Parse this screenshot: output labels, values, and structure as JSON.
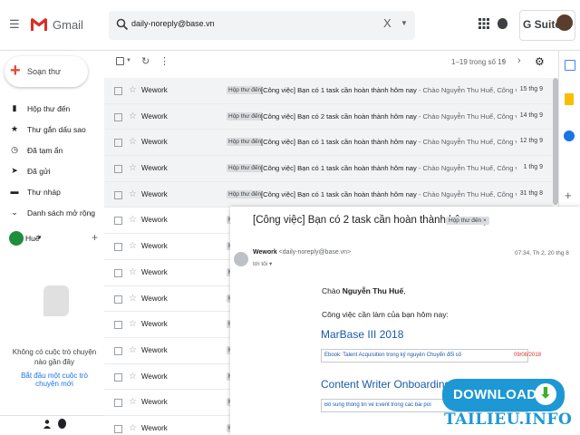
{
  "header": {
    "app_name": "Gmail",
    "search_value": "daily-noreply@base.vn",
    "clear_symbol": "X",
    "gsuite_label": "G Suite"
  },
  "sidebar": {
    "compose_label": "Soạn thư",
    "items": [
      {
        "label": "Hộp thư đến",
        "icon": "inbox-icon"
      },
      {
        "label": "Thư gắn dấu sao",
        "icon": "star-icon"
      },
      {
        "label": "Đã tạm ẩn",
        "icon": "clock-icon"
      },
      {
        "label": "Đã gửi",
        "icon": "send-icon"
      },
      {
        "label": "Thư nháp",
        "icon": "draft-icon"
      },
      {
        "label": "Danh sách mở rộng",
        "icon": "chevron-down-icon"
      }
    ],
    "chat_user": "Huế",
    "no_chat_text": "Không có cuộc trò chuyện nào gần đây",
    "start_chat_link": "Bắt đầu một cuộc trò chuyện mới"
  },
  "toolbar": {
    "pager": "1–19 trong số 19"
  },
  "emails": [
    {
      "sender": "Wework",
      "label": "Hộp thư đến",
      "subject": "[Công việc] Bạn có 1 task cần hoàn thành hôm nay",
      "snippet": " - Chào Nguyễn Thu Huế, Công việc c...",
      "date": "15 thg 9"
    },
    {
      "sender": "Wework",
      "label": "Hộp thư đến",
      "subject": "[Công việc] Bạn có 2 task cần hoàn thành hôm nay",
      "snippet": " - Chào Nguyễn Thu Huế, Công việc c...",
      "date": "14 thg 9"
    },
    {
      "sender": "Wework",
      "label": "Hộp thư đến",
      "subject": "[Công việc] Bạn có 1 task cần hoàn thành hôm nay",
      "snippet": " - Chào Nguyễn Thu Huế, Công việc c...",
      "date": "12 thg 9"
    },
    {
      "sender": "Wework",
      "label": "Hộp thư đến",
      "subject": "[Công việc] Bạn có 1 task cần hoàn thành hôm nay",
      "snippet": " - Chào Nguyễn Thu Huế, Công việc c...",
      "date": "1 thg 9"
    },
    {
      "sender": "Wework",
      "label": "Hộp thư đến",
      "subject": "[Công việc] Bạn có 1 task cần hoàn thành hôm nay",
      "snippet": " - Chào Nguyễn Thu Huế, Công việc c...",
      "date": "31 thg 8"
    },
    {
      "sender": "Wework",
      "label": "H",
      "subject": "",
      "snippet": "",
      "date": ""
    },
    {
      "sender": "Wework",
      "label": "H",
      "subject": "",
      "snippet": "",
      "date": ""
    },
    {
      "sender": "Wework",
      "label": "H",
      "subject": "",
      "snippet": "",
      "date": ""
    },
    {
      "sender": "Wework",
      "label": "H",
      "subject": "",
      "snippet": "",
      "date": ""
    },
    {
      "sender": "Wework",
      "label": "H",
      "subject": "",
      "snippet": "",
      "date": ""
    },
    {
      "sender": "Wework",
      "label": "H",
      "subject": "",
      "snippet": "",
      "date": ""
    },
    {
      "sender": "Wework",
      "label": "H",
      "subject": "",
      "snippet": "",
      "date": ""
    },
    {
      "sender": "Wework",
      "label": "H",
      "subject": "",
      "snippet": "",
      "date": ""
    },
    {
      "sender": "Wework",
      "label": "H",
      "subject": "",
      "snippet": "",
      "date": ""
    }
  ],
  "preview": {
    "subject": "[Công việc] Bạn có 2 task cần hoàn thành hôm nay",
    "inbox_tag": "Hộp thư đến",
    "from_name": "Wework",
    "from_email": "<daily-noreply@base.vn>",
    "to": "tới tôi ▾",
    "date": "07:34, Th 2, 20 thg 8",
    "greeting_prefix": "Chào ",
    "greeting_name": "Nguyễn Thu Huế",
    "greeting_suffix": ",",
    "intro": "Công việc cần làm của bạn hôm nay:",
    "project1": "MarBase III 2018",
    "task1": "Ebook: Talent Acquisition trong kỷ nguyên Chuyển đổi số",
    "task1_date": "09/08/2018",
    "project2": "Content Writer Onboarding",
    "task2": "Bổ sung thông tin về Event trong các bài post của Ta"
  },
  "watermark": {
    "download": "DOWNLOAD",
    "site": "TAILIEU.INFO"
  }
}
